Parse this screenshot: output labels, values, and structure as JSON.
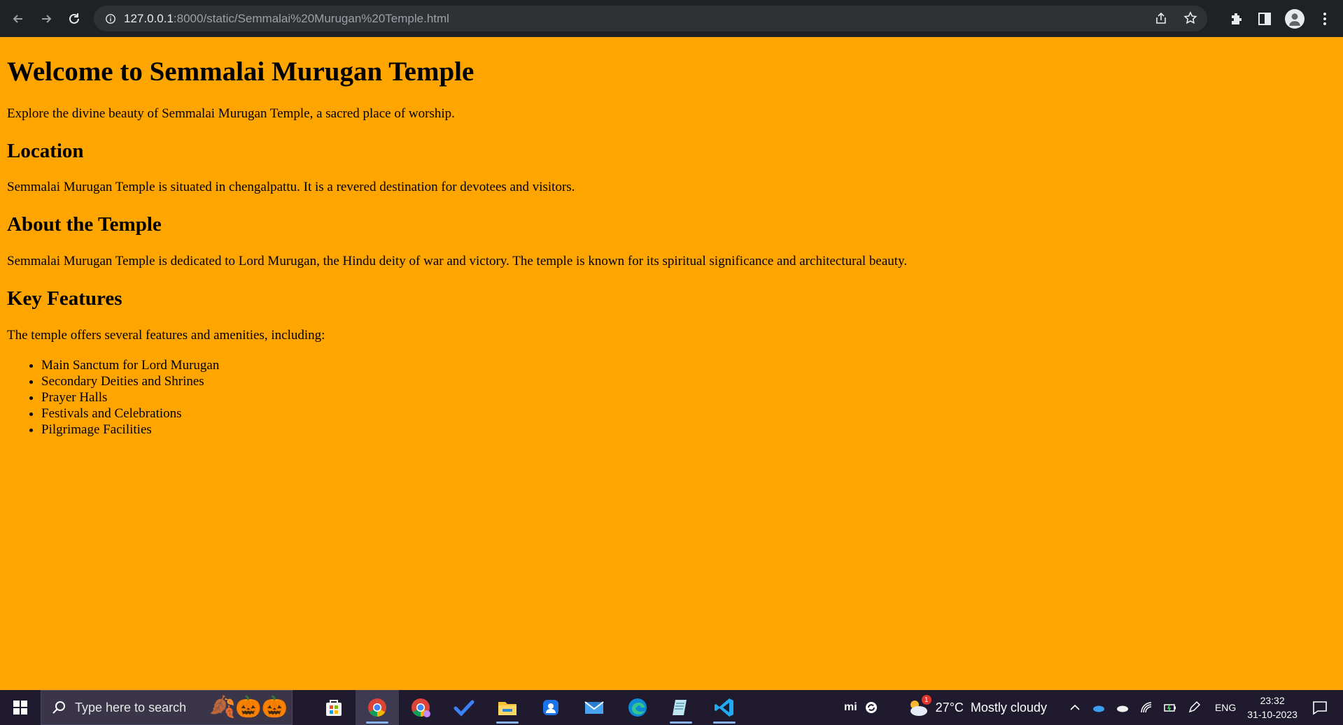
{
  "browser": {
    "url_host": "127.0.0.1",
    "url_rest": ":8000/static/Semmalai%20Murugan%20Temple.html",
    "colors": {
      "chrome_bg": "#202124",
      "omnibox_bg": "#303134"
    }
  },
  "page": {
    "background": "#ffa500",
    "title": "Welcome to Semmalai Murugan Temple",
    "intro": "Explore the divine beauty of Semmalai Murugan Temple, a sacred place of worship.",
    "location_heading": "Location",
    "location_text": "Semmalai Murugan Temple is situated in chengalpattu. It is a revered destination for devotees and visitors.",
    "about_heading": "About the Temple",
    "about_text": "Semmalai Murugan Temple is dedicated to Lord Murugan, the Hindu deity of war and victory. The temple is known for its spiritual significance and architectural beauty.",
    "features_heading": "Key Features",
    "features_intro": "The temple offers several features and amenities, including:",
    "features": [
      "Main Sanctum for Lord Murugan",
      "Secondary Deities and Shrines",
      "Prayer Halls",
      "Festivals and Celebrations",
      "Pilgrimage Facilities"
    ]
  },
  "taskbar": {
    "search_placeholder": "Type here to search",
    "pinned_apps": [
      "store-icon",
      "chrome-icon",
      "chrome-profile-icon",
      "todo-icon",
      "file-explorer-icon",
      "security-icon",
      "mail-icon",
      "edge-icon",
      "notepad-icon",
      "vscode-icon"
    ],
    "mi_label": "mi",
    "weather_temp": "27°C",
    "weather_desc": "Mostly cloudy",
    "weather_badge": "1",
    "language": "ENG",
    "time": "23:32",
    "date": "31-10-2023"
  }
}
